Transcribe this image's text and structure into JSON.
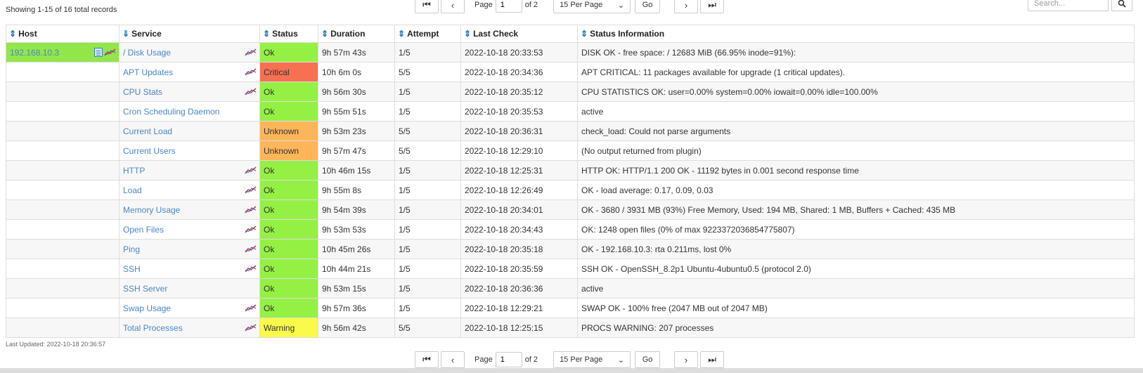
{
  "top": {
    "records_text": "Showing 1-15 of 16 total records",
    "search_placeholder": "Search..."
  },
  "pager": {
    "page_label": "Page",
    "page_value": "1",
    "of_label": "of 2",
    "per_page": "15 Per Page",
    "go_label": "Go"
  },
  "columns": {
    "host": "Host",
    "service": "Service",
    "status": "Status",
    "duration": "Duration",
    "attempt": "Attempt",
    "last_check": "Last Check",
    "status_info": "Status Information"
  },
  "host_name": "192.168.10.3",
  "rows": [
    {
      "service": "/ Disk Usage",
      "graph": true,
      "status": "Ok",
      "duration": "9h 57m 43s",
      "attempt": "1/5",
      "last_check": "2022-10-18 20:33:53",
      "info": "DISK OK - free space: / 12683 MiB (66.95% inode=91%):"
    },
    {
      "service": "APT Updates",
      "graph": true,
      "status": "Critical",
      "duration": "10h 6m 0s",
      "attempt": "5/5",
      "last_check": "2022-10-18 20:34:36",
      "info": "APT CRITICAL: 11 packages available for upgrade (1 critical updates)."
    },
    {
      "service": "CPU Stats",
      "graph": true,
      "status": "Ok",
      "duration": "9h 56m 30s",
      "attempt": "1/5",
      "last_check": "2022-10-18 20:35:12",
      "info": "CPU STATISTICS OK: user=0.00% system=0.00% iowait=0.00% idle=100.00%"
    },
    {
      "service": "Cron Scheduling Daemon",
      "graph": false,
      "status": "Ok",
      "duration": "9h 55m 51s",
      "attempt": "1/5",
      "last_check": "2022-10-18 20:35:53",
      "info": "active"
    },
    {
      "service": "Current Load",
      "graph": false,
      "status": "Unknown",
      "duration": "9h 53m 23s",
      "attempt": "5/5",
      "last_check": "2022-10-18 20:36:31",
      "info": "check_load: Could not parse arguments"
    },
    {
      "service": "Current Users",
      "graph": false,
      "status": "Unknown",
      "duration": "9h 57m 47s",
      "attempt": "5/5",
      "last_check": "2022-10-18 12:29:10",
      "info": "(No output returned from plugin)"
    },
    {
      "service": "HTTP",
      "graph": true,
      "status": "Ok",
      "duration": "10h 46m 15s",
      "attempt": "1/5",
      "last_check": "2022-10-18 12:25:31",
      "info": "HTTP OK: HTTP/1.1 200 OK - 11192 bytes in 0.001 second response time"
    },
    {
      "service": "Load",
      "graph": true,
      "status": "Ok",
      "duration": "9h 55m 8s",
      "attempt": "1/5",
      "last_check": "2022-10-18 12:26:49",
      "info": "OK - load average: 0.17, 0.09, 0.03"
    },
    {
      "service": "Memory Usage",
      "graph": true,
      "status": "Ok",
      "duration": "9h 54m 39s",
      "attempt": "1/5",
      "last_check": "2022-10-18 20:34:01",
      "info": "OK - 3680 / 3931 MB (93%) Free Memory, Used: 194 MB, Shared: 1 MB, Buffers + Cached: 435 MB"
    },
    {
      "service": "Open Files",
      "graph": true,
      "status": "Ok",
      "duration": "9h 53m 53s",
      "attempt": "1/5",
      "last_check": "2022-10-18 20:34:43",
      "info": "OK: 1248 open files (0% of max 9223372036854775807)"
    },
    {
      "service": "Ping",
      "graph": true,
      "status": "Ok",
      "duration": "10h 45m 26s",
      "attempt": "1/5",
      "last_check": "2022-10-18 20:35:18",
      "info": "OK - 192.168.10.3: rta 0.211ms, lost 0%"
    },
    {
      "service": "SSH",
      "graph": true,
      "status": "Ok",
      "duration": "10h 44m 21s",
      "attempt": "1/5",
      "last_check": "2022-10-18 20:35:59",
      "info": "SSH OK - OpenSSH_8.2p1 Ubuntu-4ubuntu0.5 (protocol 2.0)"
    },
    {
      "service": "SSH Server",
      "graph": false,
      "status": "Ok",
      "duration": "9h 53m 15s",
      "attempt": "1/5",
      "last_check": "2022-10-18 20:36:36",
      "info": "active"
    },
    {
      "service": "Swap Usage",
      "graph": true,
      "status": "Ok",
      "duration": "9h 57m 36s",
      "attempt": "1/5",
      "last_check": "2022-10-18 12:29:21",
      "info": "SWAP OK - 100% free (2047 MB out of 2047 MB)"
    },
    {
      "service": "Total Processes",
      "graph": true,
      "status": "Warning",
      "duration": "9h 56m 42s",
      "attempt": "5/5",
      "last_check": "2022-10-18 12:25:15",
      "info": "PROCS WARNING: 207 processes"
    }
  ],
  "footer": {
    "last_updated": "Last Updated: 2022-10-18 20:36:57"
  },
  "colors": {
    "ok": "#95f044",
    "critical": "#f77052",
    "unknown": "#fdb55a",
    "warning": "#fafa4a",
    "host_up": "#92e64a",
    "link": "#4a86c5"
  }
}
